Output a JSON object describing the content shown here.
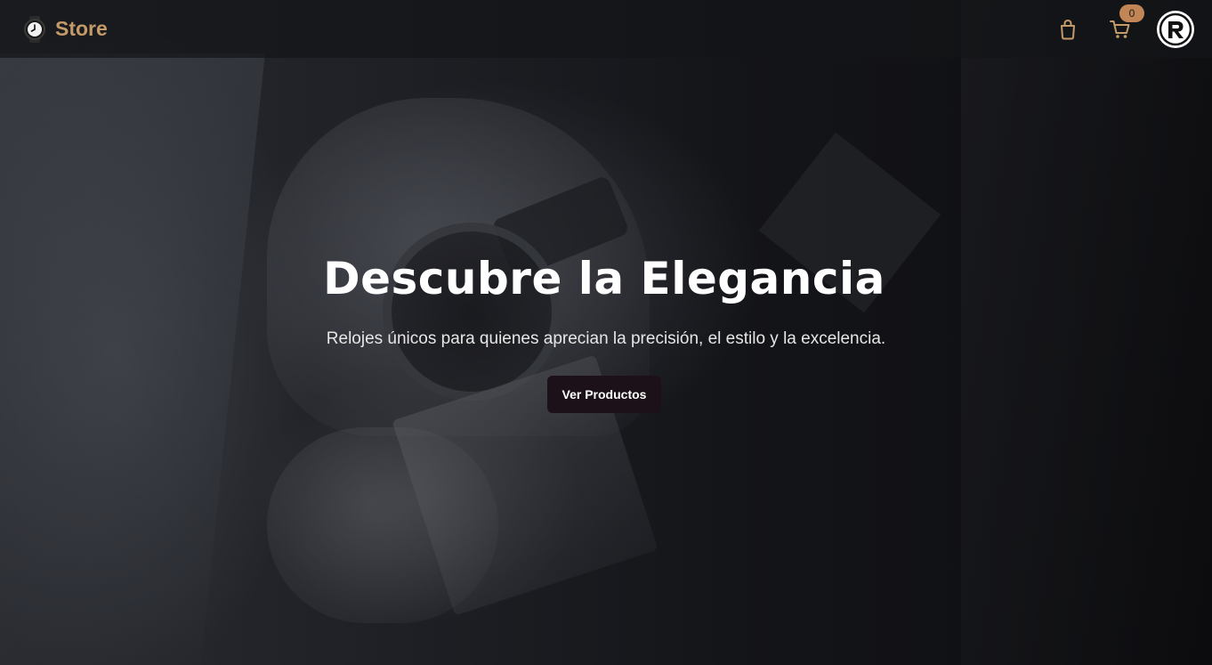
{
  "navbar": {
    "brand_name": "Store",
    "brand_icon": "watch-icon",
    "bag_icon": "shopping-bag-icon",
    "cart_icon": "shopping-cart-icon",
    "cart_count": "0",
    "avatar_icon": "r-logo-avatar"
  },
  "hero": {
    "title": "Descubre la Elegancia",
    "subtitle": "Relojes únicos para quienes aprecian la precisión, el estilo y la excelencia.",
    "cta_label": "Ver Productos"
  },
  "colors": {
    "accent": "#c49a68",
    "badge": "#c28556",
    "button_bg": "#1c1118"
  }
}
